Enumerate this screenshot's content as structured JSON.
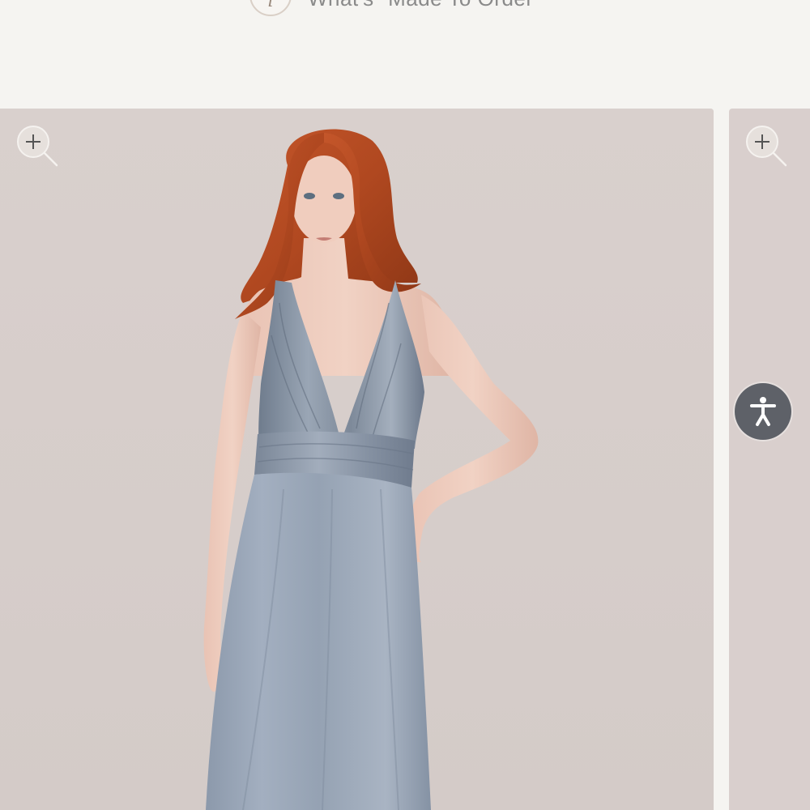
{
  "info": {
    "icon": "info-icon",
    "icon_glyph": "i",
    "label": "What's \"Made To Order\""
  },
  "gallery": {
    "images": [
      {
        "alt": "Model wearing blue-gray satin halter gown",
        "zoom_icon": "zoom-in-icon"
      },
      {
        "alt": "Next product image",
        "zoom_icon": "zoom-in-icon"
      }
    ]
  },
  "accessibility": {
    "icon": "accessibility-icon",
    "label": "Accessibility menu",
    "color": "#5e6168"
  }
}
